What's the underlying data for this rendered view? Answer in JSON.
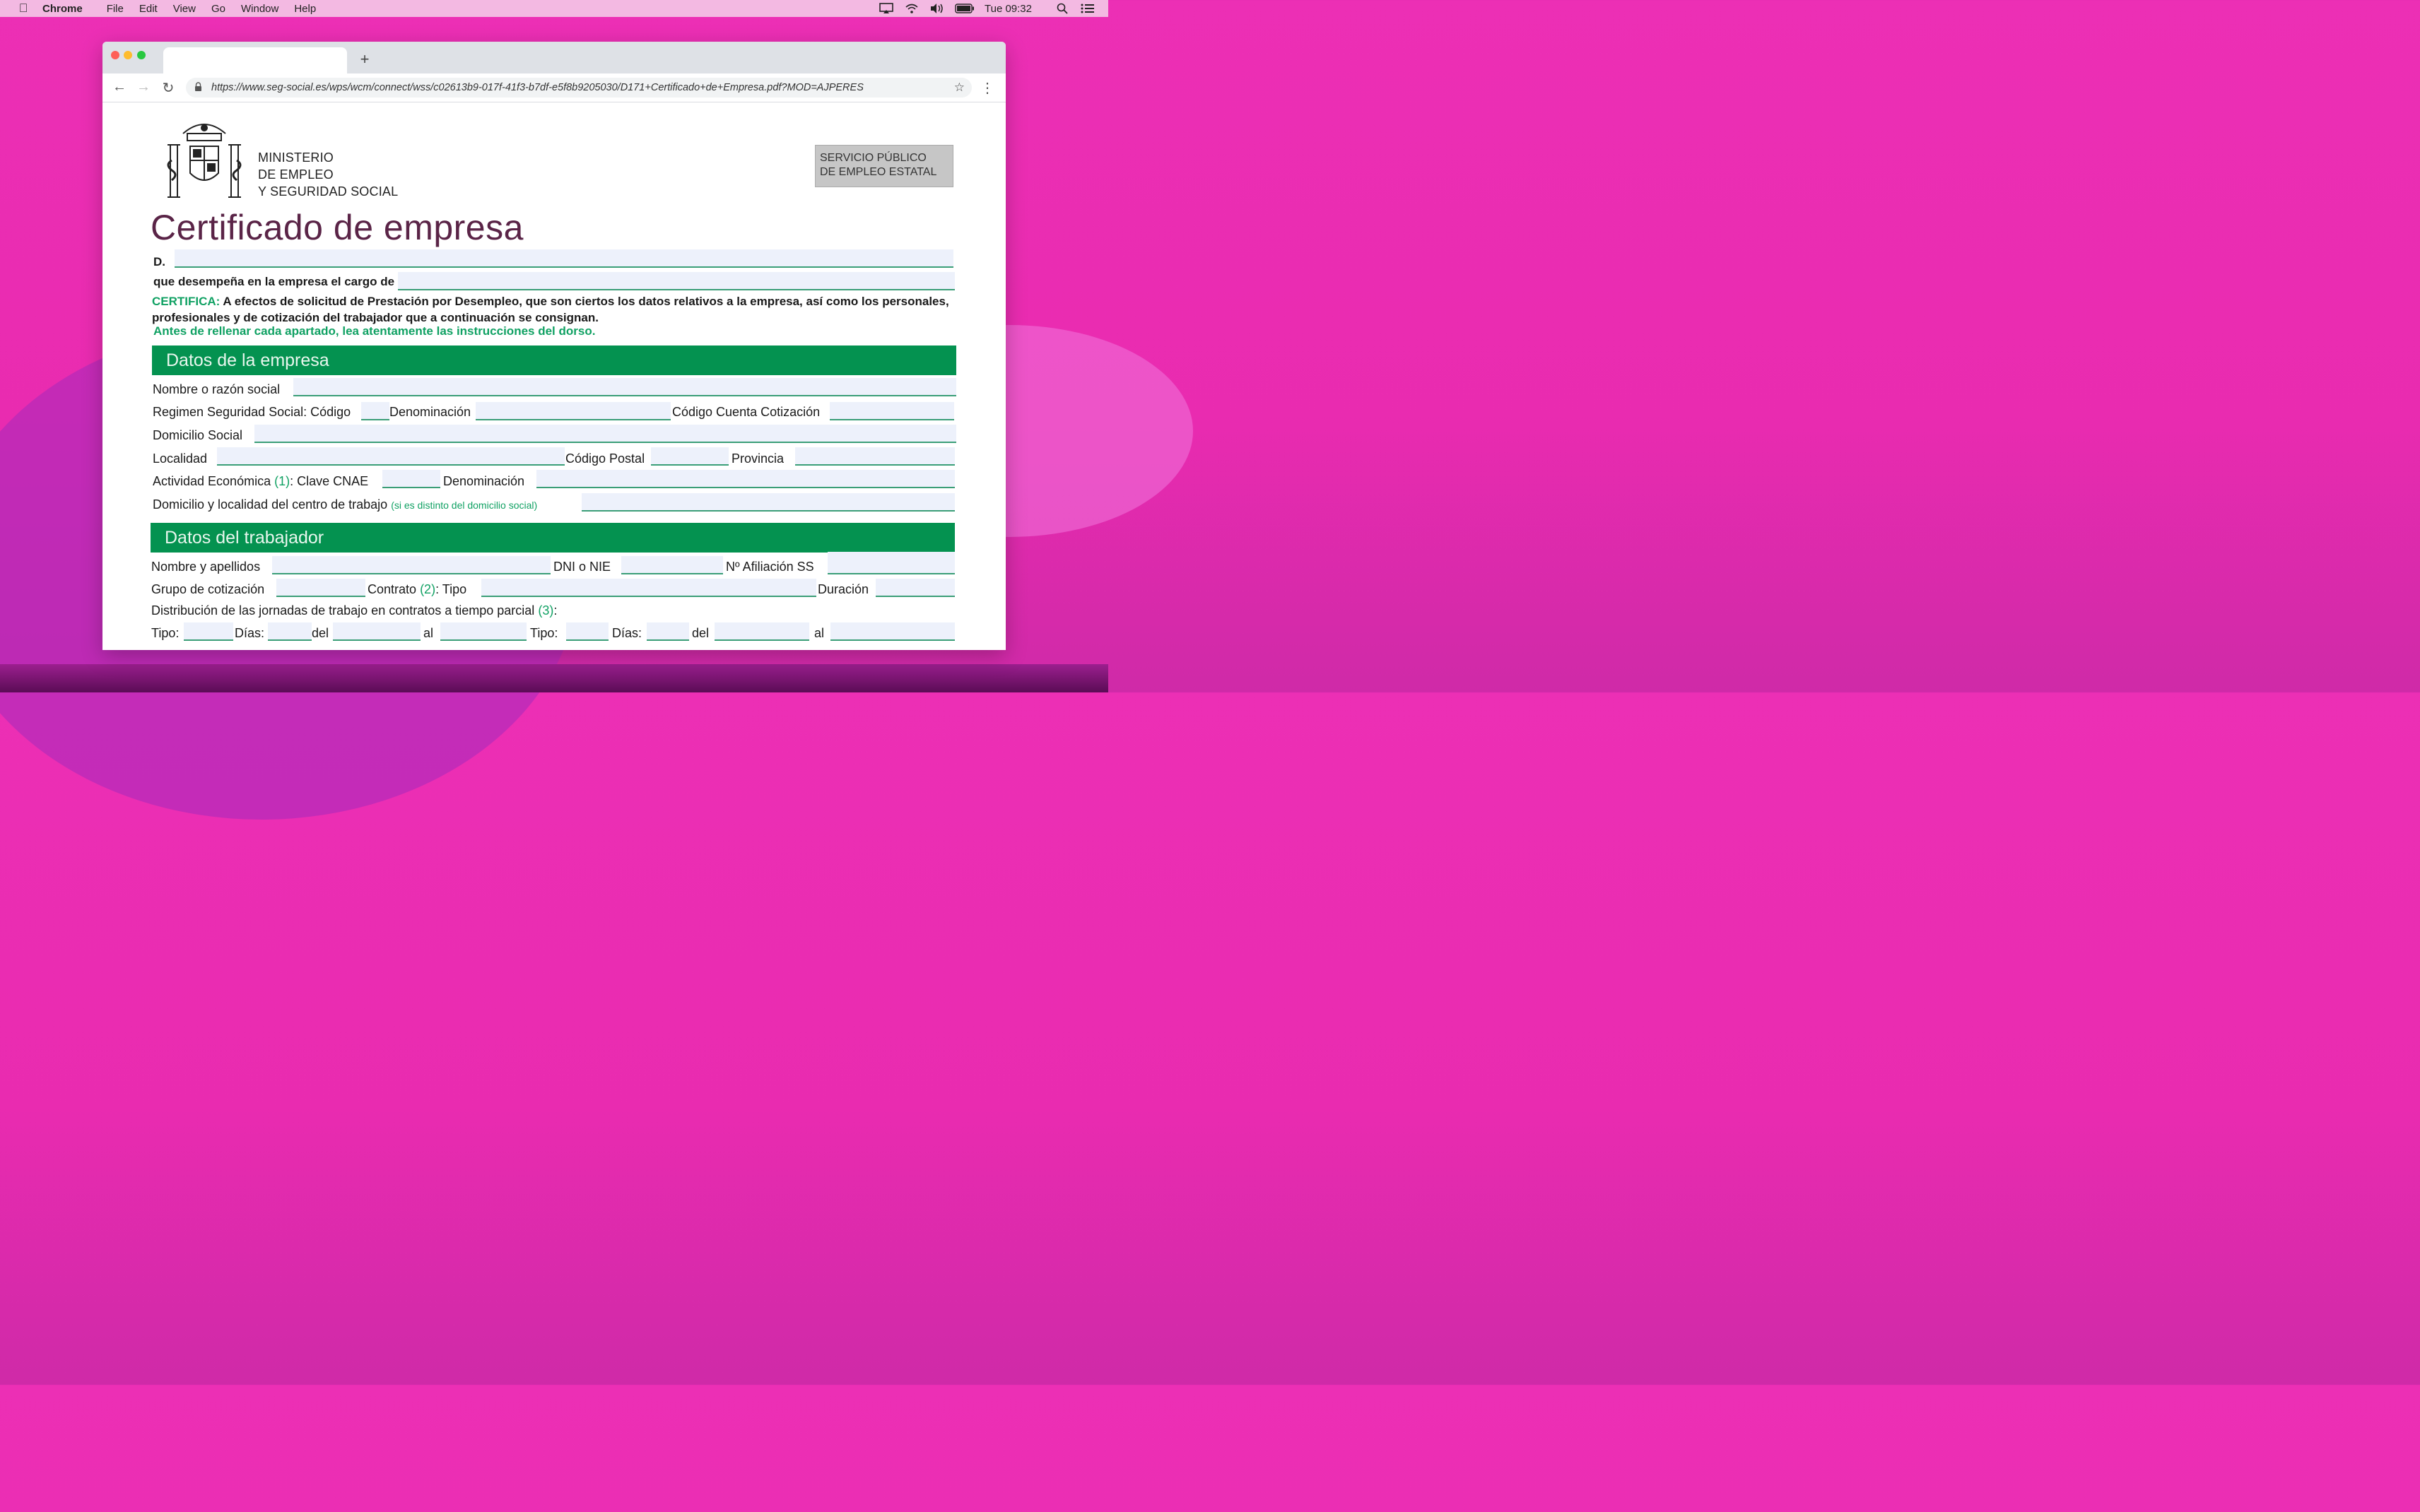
{
  "menubar": {
    "app": "Chrome",
    "items": [
      "File",
      "Edit",
      "View",
      "Go",
      "Window",
      "Help"
    ],
    "clock": "Tue 09:32"
  },
  "browser": {
    "url": "https://www.seg-social.es/wps/wcm/connect/wss/c02613b9-017f-41f3-b7df-e5f8b9205030/D171+Certificado+de+Empresa.pdf?MOD=AJPERES"
  },
  "doc": {
    "ministry": [
      "MINISTERIO",
      "DE EMPLEO",
      "Y SEGURIDAD SOCIAL"
    ],
    "sepe": [
      "SERVICIO PÚBLICO",
      "DE EMPLEO ESTATAL"
    ],
    "title": "Certificado de empresa",
    "d_label": "D.",
    "cargo_label": "que desempeña en la empresa el cargo de",
    "cert_keyword": "CERTIFICA:",
    "cert_text": "A efectos de solicitud de Prestación por Desempleo, que son ciertos los datos relativos a la empresa, así como los personales, profesionales y de cotización del trabajador que a continuación se consignan.",
    "note": "Antes de rellenar cada apartado, lea  atentamente las instrucciones del dorso.",
    "empresa": {
      "heading": "Datos de la empresa",
      "nombre": "Nombre o razón social",
      "regimen": "Regimen Seguridad Social: Código",
      "denominacion": "Denominación",
      "ccc": "Código Cuenta Cotización",
      "domicilio": "Domicilio Social",
      "localidad": "Localidad",
      "cp": "Código Postal",
      "provincia": "Provincia",
      "actividad": "Actividad Económica",
      "actividad_ref": "(1)",
      "cnae": ": Clave CNAE",
      "denominacion2": "Denominación",
      "centro": "Domicilio y localidad del centro de trabajo",
      "centro_note": "(si es distinto del domicilio social)"
    },
    "trabajador": {
      "heading": "Datos del trabajador",
      "nombre": "Nombre y apellidos",
      "dni": "DNI o NIE",
      "afiliacion": "Nº  Afiliación SS",
      "grupo": "Grupo de cotización",
      "contrato": "Contrato",
      "contrato_ref": "(2)",
      "tipo": ": Tipo",
      "duracion": "Duración",
      "distribucion": "Distribución de las jornadas de trabajo en contratos a tiempo parcial",
      "distribucion_ref": "(3)",
      "distribucion_colon": ":",
      "tipo1": "Tipo:",
      "dias1": "Días:",
      "del1": "del",
      "al1": "al",
      "tipo2": "Tipo:",
      "dias2": "Días:",
      "del2": "del",
      "al2": "al"
    }
  }
}
